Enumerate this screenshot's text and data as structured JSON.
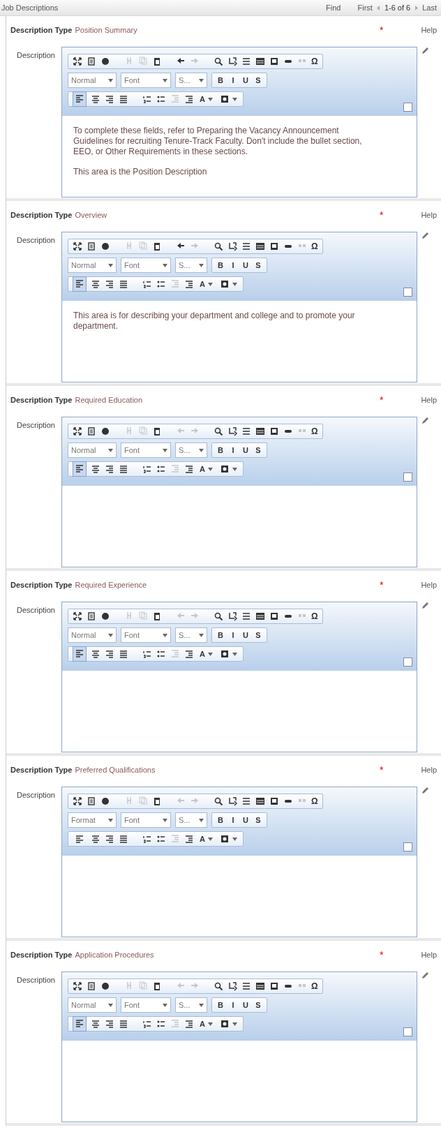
{
  "header": {
    "title": "Job Descriptions",
    "find": "Find",
    "first": "First",
    "range": "1-6 of 6",
    "last": "Last"
  },
  "toolbar": {
    "cut_disabled": true,
    "copy_disabled": true,
    "unlink_disabled": true,
    "outdent_disabled": true
  },
  "sections": [
    {
      "type_label": "Description Type",
      "type_value": "Position Summary",
      "required": "*",
      "help": "Help",
      "field_label": "Description",
      "editor": {
        "format": "Normal",
        "font": "Font",
        "size": "S...",
        "style_buttons": [
          "B",
          "I",
          "U",
          "S"
        ],
        "special_char": "Ω",
        "text_color": "A",
        "undo_disabled": false,
        "redo_disabled": true,
        "align_left_selected": true,
        "paragraphs": [
          "To complete these fields, refer to Preparing the Vacancy Announcement Guidelines for recruiting Tenure-Track Faculty. Don't include the bullet section, EEO, or Other Requirements in these sections.",
          "This area is the Position Description"
        ]
      }
    },
    {
      "type_label": "Description Type",
      "type_value": "Overview",
      "required": "*",
      "help": "Help",
      "field_label": "Description",
      "editor": {
        "format": "Normal",
        "font": "Font",
        "size": "S...",
        "style_buttons": [
          "B",
          "I",
          "U",
          "S"
        ],
        "special_char": "Ω",
        "text_color": "A",
        "undo_disabled": false,
        "redo_disabled": true,
        "align_left_selected": true,
        "paragraphs": [
          "This area is for describing your department and college and to promote your department."
        ]
      }
    },
    {
      "type_label": "Description Type",
      "type_value": "Required Education",
      "required": "*",
      "help": "Help",
      "field_label": "Description",
      "editor": {
        "format": "Normal",
        "font": "Font",
        "size": "S...",
        "style_buttons": [
          "B",
          "I",
          "U",
          "S"
        ],
        "special_char": "Ω",
        "text_color": "A",
        "undo_disabled": true,
        "redo_disabled": true,
        "align_left_selected": true
      }
    },
    {
      "type_label": "Description Type",
      "type_value": "Required Experience",
      "required": "*",
      "help": "Help",
      "field_label": "Description",
      "editor": {
        "format": "Normal",
        "font": "Font",
        "size": "S...",
        "style_buttons": [
          "B",
          "I",
          "U",
          "S"
        ],
        "special_char": "Ω",
        "text_color": "A",
        "undo_disabled": true,
        "redo_disabled": true,
        "align_left_selected": true
      }
    },
    {
      "type_label": "Description Type",
      "type_value": "Preferred Qualifications",
      "required": "*",
      "help": "Help",
      "field_label": "Description",
      "editor": {
        "format": "Format",
        "font": "Font",
        "size": "S...",
        "style_buttons": [
          "B",
          "I",
          "U",
          "S"
        ],
        "special_char": "Ω",
        "text_color": "A",
        "undo_disabled": true,
        "redo_disabled": true,
        "align_left_selected": false
      }
    },
    {
      "type_label": "Description Type",
      "type_value": "Application Procedures",
      "required": "*",
      "help": "Help",
      "field_label": "Description",
      "editor": {
        "format": "Normal",
        "font": "Font",
        "size": "S...",
        "style_buttons": [
          "B",
          "I",
          "U",
          "S"
        ],
        "special_char": "Ω",
        "text_color": "A",
        "undo_disabled": true,
        "redo_disabled": true,
        "align_left_selected": true
      }
    }
  ]
}
